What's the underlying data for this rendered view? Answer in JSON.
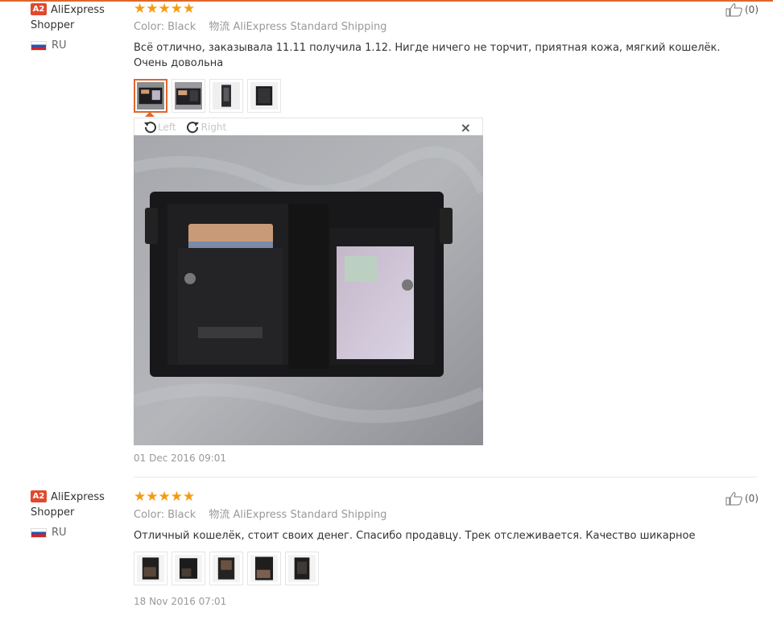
{
  "reviews": [
    {
      "badge": "A2",
      "user_name": "AliExpress Shopper",
      "country": "RU",
      "stars": "★★★★★",
      "color_label": "Color:",
      "color_value": "Black",
      "shipping_label": "物流",
      "shipping_value": "AliExpress Standard Shipping",
      "text": "Всё отлично, заказывала 11.11 получила 1.12. Нигде ничего не торчит, приятная кожа, мягкий кошелёк. Очень довольна",
      "likes": "(0)",
      "date": "01 Dec 2016 09:01",
      "viewer": {
        "left_label": "Left",
        "right_label": "Right",
        "close_label": "×"
      }
    },
    {
      "badge": "A2",
      "user_name": "AliExpress Shopper",
      "country": "RU",
      "stars": "★★★★★",
      "color_label": "Color:",
      "color_value": "Black",
      "shipping_label": "物流",
      "shipping_value": "AliExpress Standard Shipping",
      "text": "Отличный кошелёк, стоит своих денег. Спасибо продавцу. Трек отслеживается. Качество шикарное",
      "likes": "(0)",
      "date": "18 Nov 2016 07:01"
    }
  ],
  "colors": {
    "accent": "#e0662a",
    "star": "#f39c12",
    "badge": "#e0492e"
  }
}
